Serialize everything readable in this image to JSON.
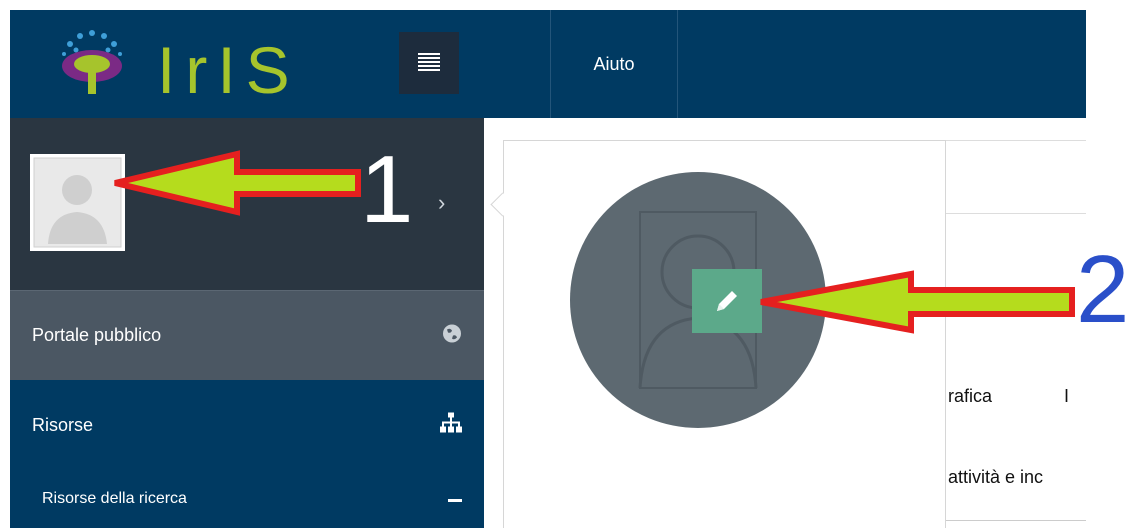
{
  "header": {
    "logo_text": "IrIS",
    "menu_icon": "hamburger-icon",
    "nav": [
      {
        "label": "Aiuto"
      }
    ]
  },
  "sidebar": {
    "user": {
      "avatar_icon": "user-avatar-icon",
      "chevron_icon": "chevron-right-icon"
    },
    "items": [
      {
        "label": "Portale pubblico",
        "icon": "globe-icon"
      },
      {
        "label": "Risorse",
        "icon": "sitemap-icon"
      },
      {
        "label": "Risorse della ricerca",
        "icon": "minus-icon"
      }
    ]
  },
  "popover": {
    "avatar_icon": "user-avatar-icon",
    "edit_icon": "pencil-icon"
  },
  "content": {
    "fragment_1": "rafica",
    "fragment_2": "I",
    "fragment_3": "attività e inc"
  },
  "annotations": {
    "label_1": "1",
    "label_2": "2",
    "arrow_color": "#e5201f",
    "arrow_fill": "#b5dc1d",
    "label_2_color": "#2a4fc9"
  },
  "colors": {
    "topbar": "#003a62",
    "sidebar_user_bg": "#2a3641",
    "sidebar_portale_bg": "#4b5763",
    "logo_green": "#a6c42c",
    "edit_green": "#5ca98a"
  }
}
